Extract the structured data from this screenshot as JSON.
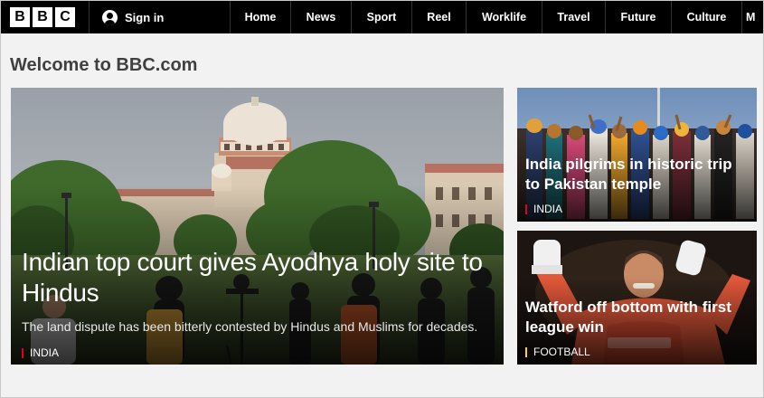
{
  "nav": {
    "logo_letters": [
      "B",
      "B",
      "C"
    ],
    "signin_label": "Sign in",
    "items": [
      "Home",
      "News",
      "Sport",
      "Reel",
      "Worklife",
      "Travel",
      "Future",
      "Culture",
      "M"
    ]
  },
  "page": {
    "welcome": "Welcome to BBC.com"
  },
  "main_story": {
    "title": "Indian top court gives Ayodhya holy site to Hindus",
    "summary": "The land dispute has been bitterly contested by Hindus and Muslims for decades.",
    "tag": "INDIA",
    "tag_color": "#e3001b"
  },
  "story_2": {
    "title": "India pilgrims in historic trip to Pakistan temple",
    "tag": "INDIA",
    "tag_color": "#e3001b"
  },
  "story_3": {
    "title": "Watford off bottom with first league win",
    "tag": "FOOTBALL",
    "tag_color": "#ffd230"
  },
  "colors": {
    "nav_bg": "#000000",
    "page_bg": "#f2f2f2",
    "heading": "#404040"
  }
}
